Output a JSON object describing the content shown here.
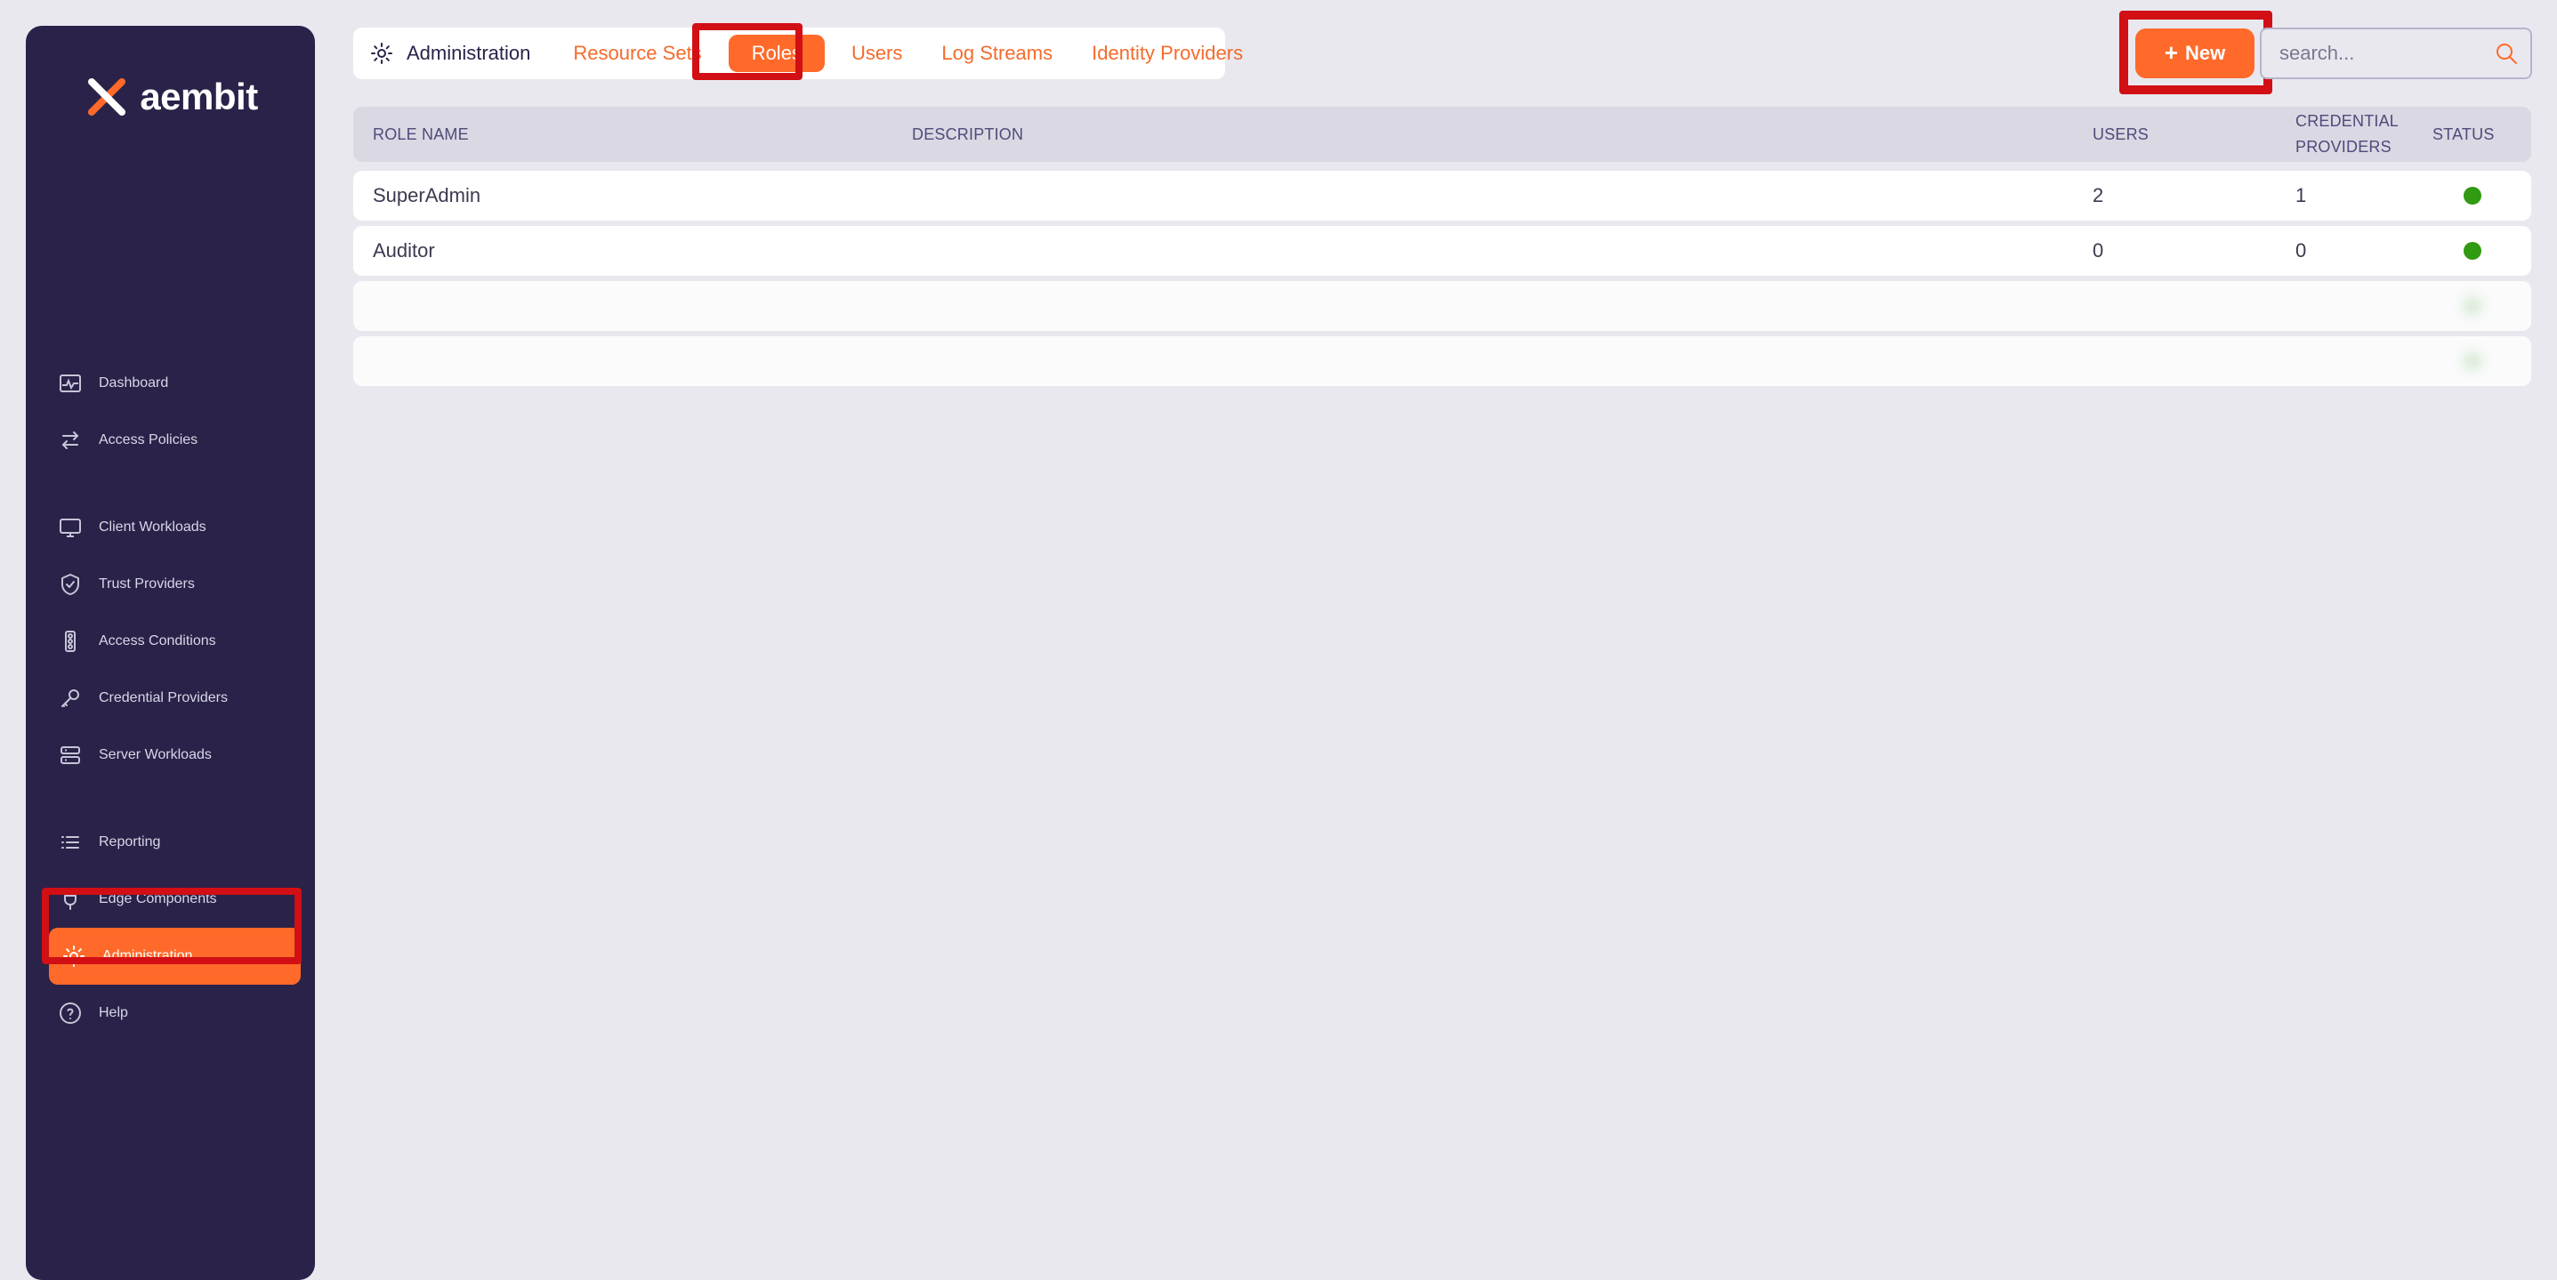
{
  "colors": {
    "sidebar_bg": "#2A2248",
    "page_bg": "#E9E8EF",
    "accent": "#FF6A2A",
    "highlight": "#D10F15",
    "status_active": "#2F9A12"
  },
  "brand": {
    "logo_text": "aembit",
    "logo_icon": "x-logo-icon"
  },
  "sidebar": {
    "groups": [
      {
        "items": [
          {
            "label": "Dashboard",
            "icon": "pulse-icon"
          },
          {
            "label": "Access Policies",
            "icon": "swap-arrows-icon"
          }
        ]
      },
      {
        "items": [
          {
            "label": "Client Workloads",
            "icon": "monitor-icon"
          },
          {
            "label": "Trust Providers",
            "icon": "shield-check-icon"
          },
          {
            "label": "Access Conditions",
            "icon": "traffic-light-icon"
          },
          {
            "label": "Credential Providers",
            "icon": "key-icon"
          },
          {
            "label": "Server Workloads",
            "icon": "server-icon"
          }
        ]
      },
      {
        "items": [
          {
            "label": "Reporting",
            "icon": "list-icon"
          },
          {
            "label": "Edge Components",
            "icon": "plug-icon"
          },
          {
            "label": "Administration",
            "icon": "gear-icon",
            "active": true
          },
          {
            "label": "Help",
            "icon": "help-circle-icon"
          }
        ]
      }
    ]
  },
  "header": {
    "breadcrumb": {
      "label": "Administration",
      "icon": "gear-icon"
    },
    "tabs": [
      {
        "label": "Resource Sets"
      },
      {
        "label": "Roles",
        "active": true
      },
      {
        "label": "Users"
      },
      {
        "label": "Log Streams"
      },
      {
        "label": "Identity Providers"
      }
    ],
    "new_button": {
      "label": "New",
      "icon": "plus-icon"
    },
    "search": {
      "placeholder": "search...",
      "value": ""
    }
  },
  "table": {
    "columns": [
      "ROLE NAME",
      "DESCRIPTION",
      "USERS",
      "CREDENTIAL\nPROVIDERS",
      "STATUS"
    ],
    "rows": [
      {
        "role_name": "SuperAdmin",
        "description": "",
        "users": "2",
        "credential_providers": "1",
        "status": "active"
      },
      {
        "role_name": "Auditor",
        "description": "",
        "users": "0",
        "credential_providers": "0",
        "status": "active"
      },
      {
        "role_name": "",
        "description": "",
        "users": "",
        "credential_providers": "",
        "status": "active",
        "blurred": true
      },
      {
        "role_name": "",
        "description": "",
        "users": "",
        "credential_providers": "",
        "status": "active",
        "blurred": true
      }
    ]
  }
}
